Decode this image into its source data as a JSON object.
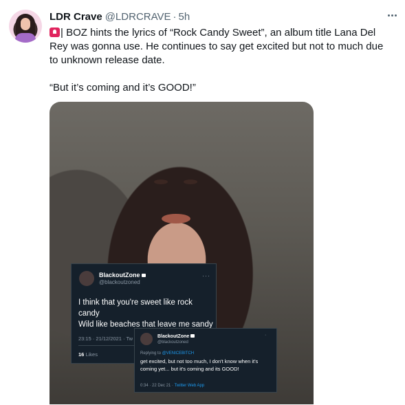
{
  "tweet": {
    "display_name": "LDR Crave",
    "handle": "@LDRCRAVE",
    "separator": "·",
    "time": "5h",
    "body_line1": "| BOZ hints the lyrics of “Rock Candy Sweet”, an album title Lana Del Rey was gonna use. He continues to say get excited but not to much due to unknown release date.",
    "body_line2": "“But it’s coming and it’s GOOD!”",
    "icons": [
      "police-light-emoji",
      "more-icon"
    ]
  },
  "embedded": {
    "card1": {
      "name": "BlackoutZone",
      "handle": "@blackoutzoned",
      "more": "···",
      "text_line1": "I think that you're sweet like rock",
      "text_line2": "candy",
      "text_line3": "Wild like beaches that leave me sandy",
      "meta": "23:15 · 21/12/2021 · Tw",
      "likes_count": "16",
      "likes_label": "Likes"
    },
    "card2": {
      "name": "BlackoutZone",
      "handle": "@blackoutzoned",
      "replying_prefix": "Replying to",
      "replying_to": "@VENICEBITCH",
      "text": "get excited, but not too much, I don't know when it's coming yet... but it's coming and its GOOD!",
      "meta_time": "0:34 · 22 Dec 21 ·",
      "meta_source": "Twitter Web App"
    }
  }
}
